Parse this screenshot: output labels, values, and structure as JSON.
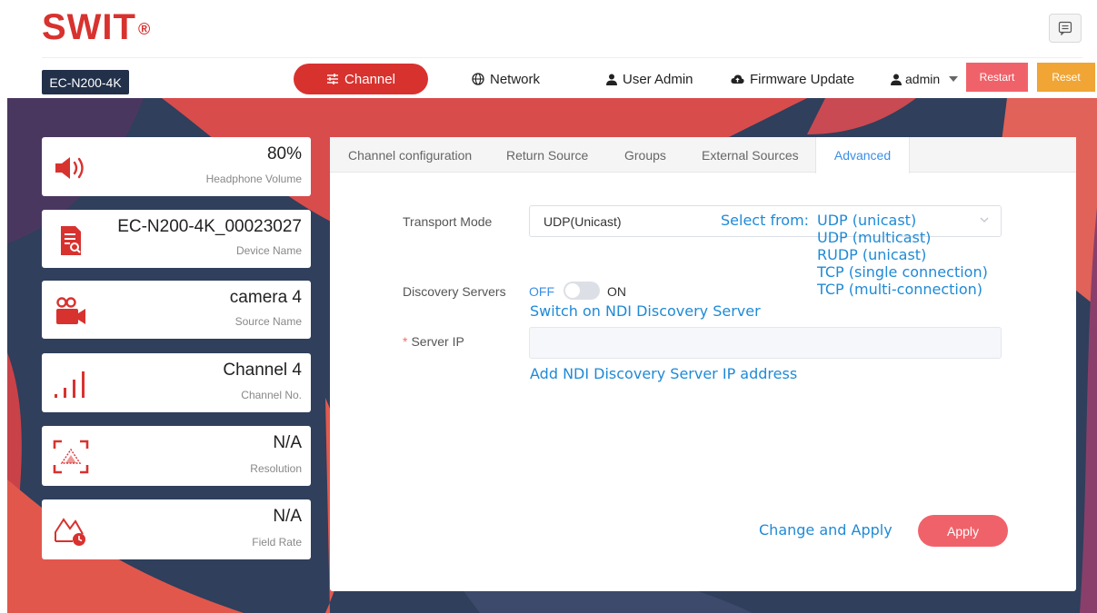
{
  "header": {
    "logo": "SWIT",
    "logo_mark": "®",
    "device": "EC-N200-4K"
  },
  "nav": {
    "channel": "Channel",
    "network": "Network",
    "user_admin": "User Admin",
    "firmware": "Firmware Update",
    "admin": "admin",
    "restart": "Restart",
    "reset": "Reset"
  },
  "cards": [
    {
      "value": "80%",
      "label": "Headphone Volume",
      "icon": "speaker-icon"
    },
    {
      "value": "EC-N200-4K_00023027",
      "label": "Device Name",
      "icon": "device-icon"
    },
    {
      "value": "camera 4",
      "label": "Source Name",
      "icon": "camera-icon"
    },
    {
      "value": "Channel 4",
      "label": "Channel No.",
      "icon": "signal-icon"
    },
    {
      "value": "N/A",
      "label": "Resolution",
      "icon": "resolution-icon"
    },
    {
      "value": "N/A",
      "label": "Field Rate",
      "icon": "field-rate-icon"
    }
  ],
  "tabs": [
    "Channel configuration",
    "Return Source",
    "Groups",
    "External Sources",
    "Advanced"
  ],
  "form": {
    "transport_label": "Transport Mode",
    "transport_value": "UDP(Unicast)",
    "discovery_label": "Discovery Servers",
    "toggle_off": "OFF",
    "toggle_on": "ON",
    "server_ip_label": "Server IP",
    "server_ip_required": "*",
    "apply": "Apply"
  },
  "annotations": {
    "select_from": "Select from:",
    "options": [
      "UDP (unicast)",
      "UDP (multicast)",
      "RUDP (unicast)",
      "TCP (single connection)",
      "TCP (multi-connection)"
    ],
    "switch_on": "Switch on NDI Discovery Server",
    "add_ip": "Add NDI Discovery Server IP address",
    "change_apply": "Change and Apply"
  },
  "colors": {
    "brand_red": "#d8322f",
    "navy": "#22304a",
    "link_blue": "#3a8ee6",
    "annotation_blue": "#1f8ad6",
    "restart": "#f0626a",
    "reset": "#f0a535"
  }
}
